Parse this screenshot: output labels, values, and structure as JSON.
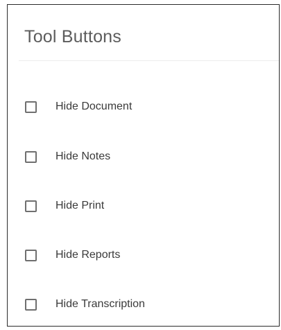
{
  "panel": {
    "title": "Tool Buttons"
  },
  "options": [
    {
      "label": "Hide Document",
      "checked": false
    },
    {
      "label": "Hide Notes",
      "checked": false
    },
    {
      "label": "Hide Print",
      "checked": false
    },
    {
      "label": "Hide Reports",
      "checked": false
    },
    {
      "label": "Hide Transcription",
      "checked": false
    }
  ]
}
